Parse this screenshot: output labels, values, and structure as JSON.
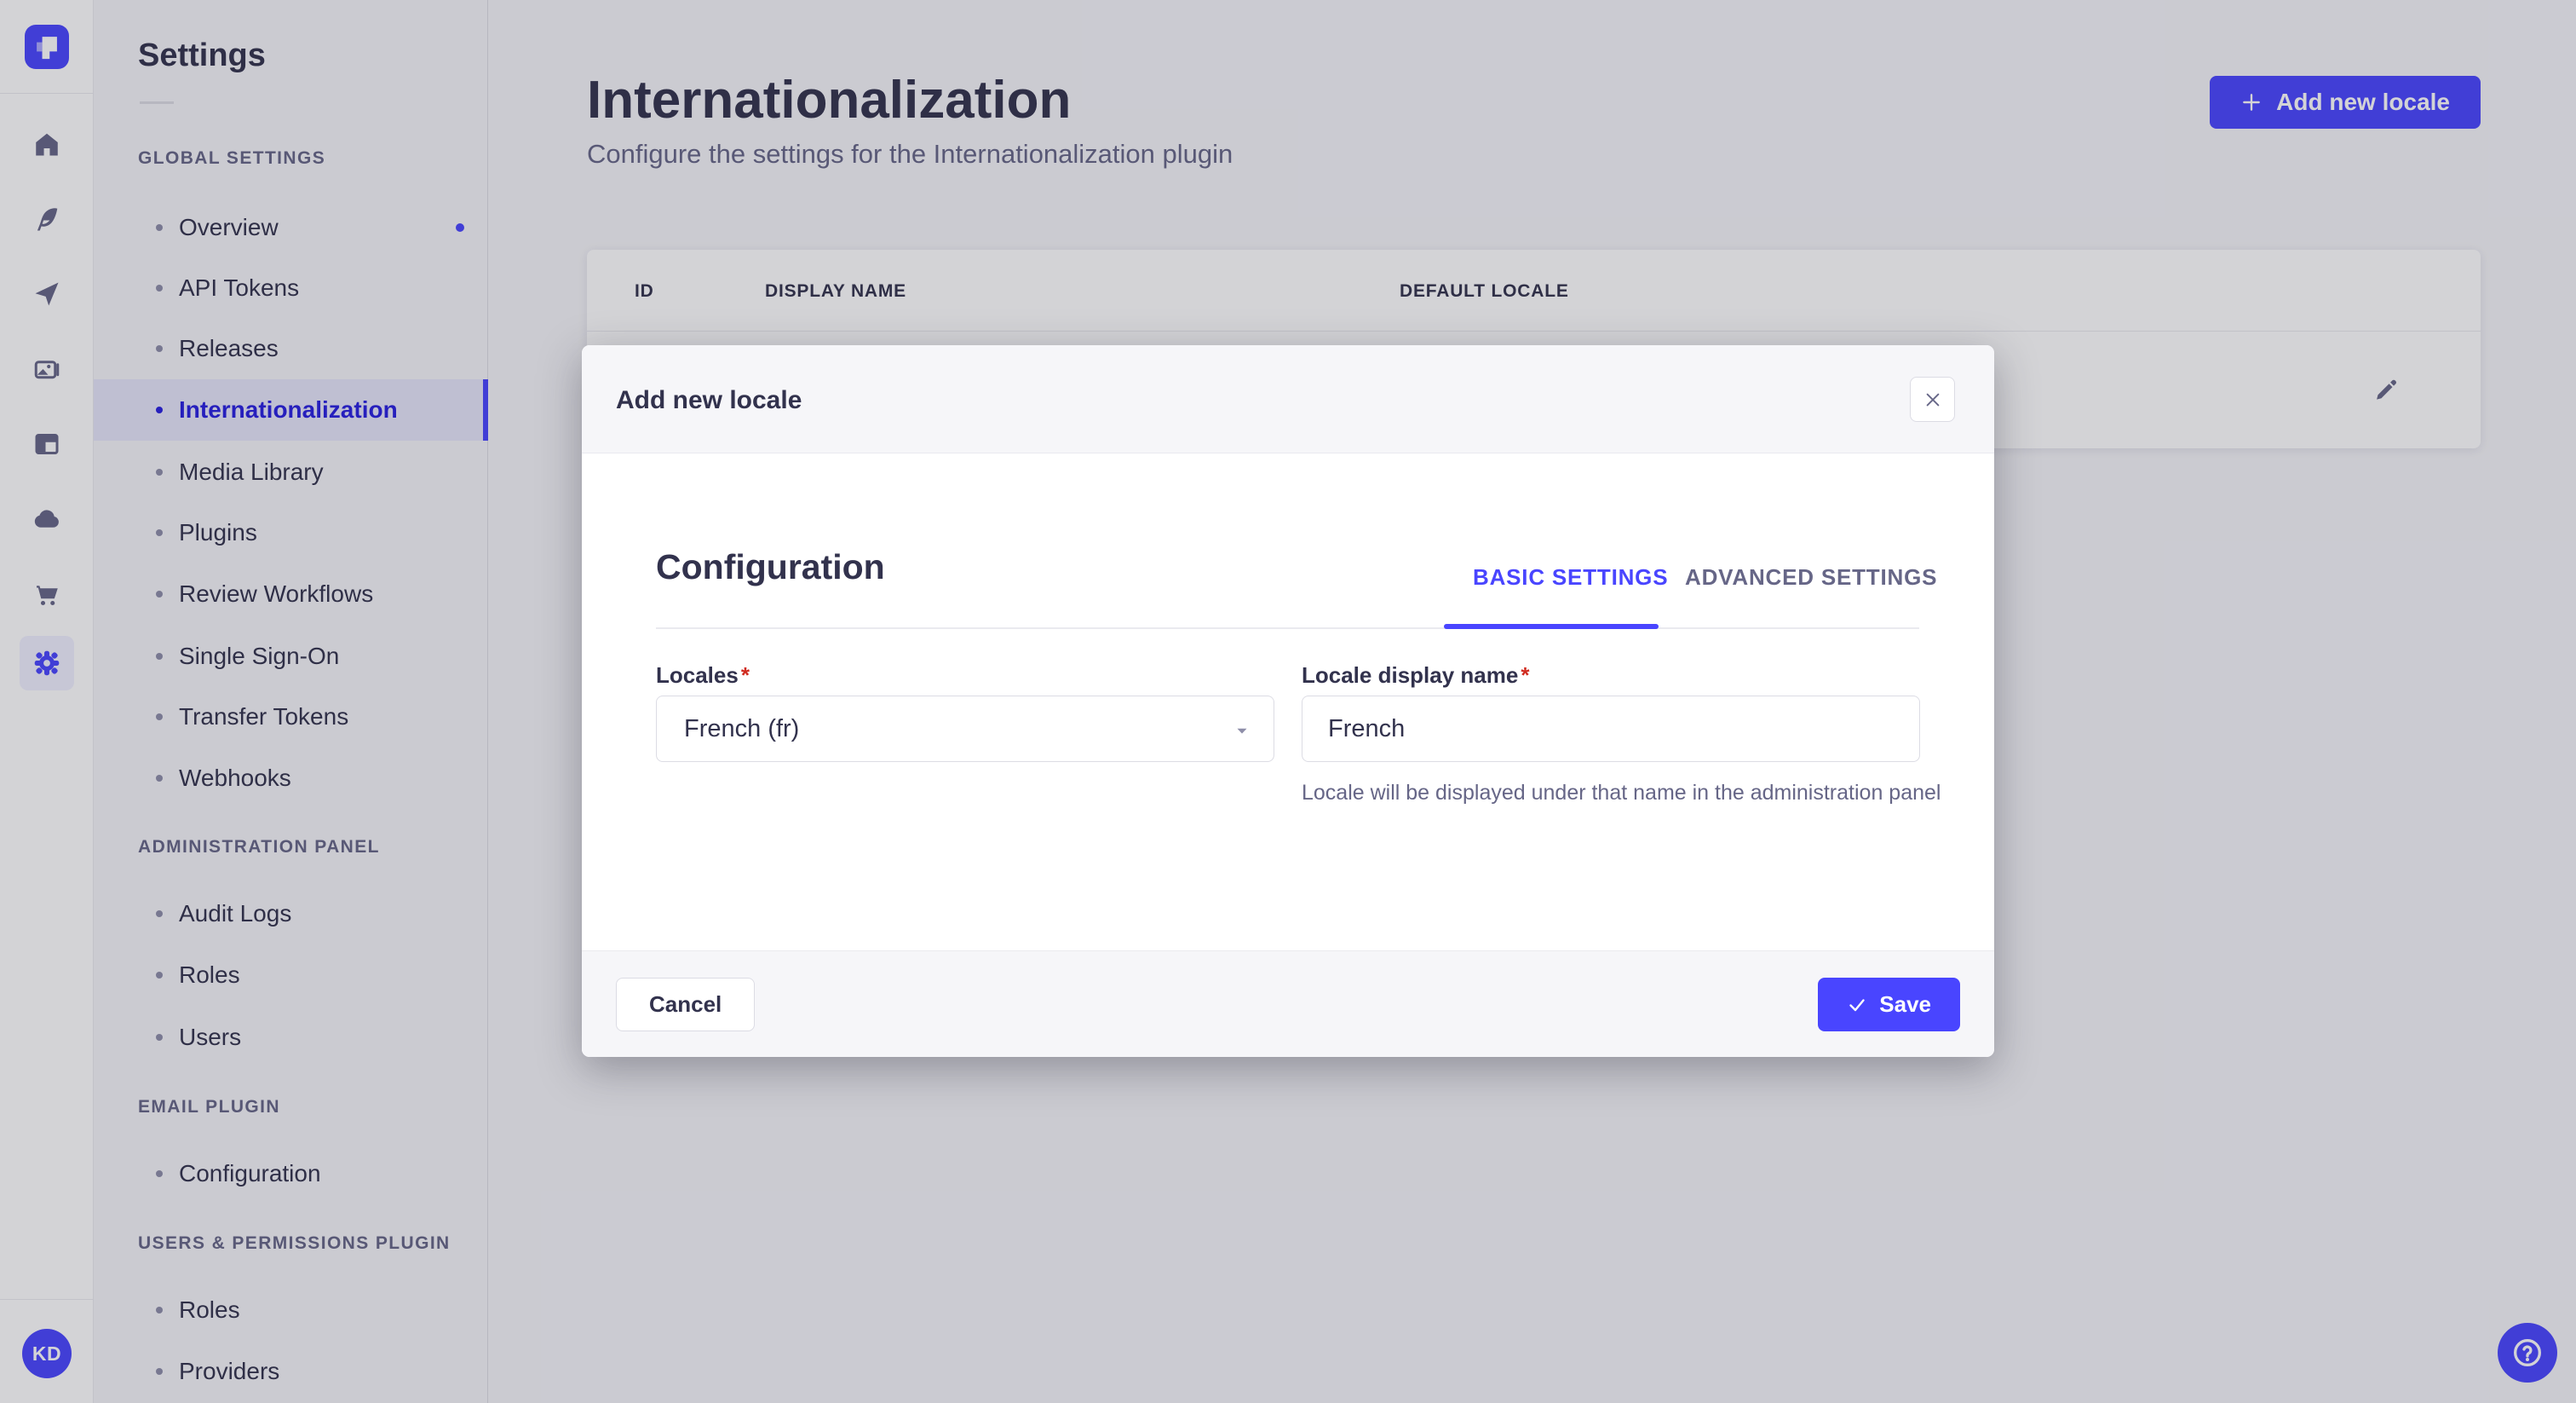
{
  "colors": {
    "brand": "#4945ff",
    "active_link": "#271fe0",
    "danger": "#d02b20",
    "overlay": "rgba(33,33,52,0.2)"
  },
  "rail": {
    "logo_icon": "strapi-logo-icon",
    "icons": [
      "home-icon",
      "feather-icon",
      "paper-plane-icon",
      "media-library-icon",
      "layout-icon",
      "cloud-icon",
      "cart-icon",
      "gear-icon"
    ],
    "active_icon": "gear-icon",
    "avatar_initials": "KD"
  },
  "sidebar": {
    "title": "Settings",
    "sections": [
      {
        "header": "GLOBAL SETTINGS",
        "items": [
          {
            "label": "Overview",
            "notification": true
          },
          {
            "label": "API Tokens"
          },
          {
            "label": "Releases"
          },
          {
            "label": "Internationalization",
            "active": true
          },
          {
            "label": "Media Library"
          },
          {
            "label": "Plugins"
          },
          {
            "label": "Review Workflows"
          },
          {
            "label": "Single Sign-On"
          },
          {
            "label": "Transfer Tokens"
          },
          {
            "label": "Webhooks"
          }
        ]
      },
      {
        "header": "ADMINISTRATION PANEL",
        "items": [
          {
            "label": "Audit Logs"
          },
          {
            "label": "Roles"
          },
          {
            "label": "Users"
          }
        ]
      },
      {
        "header": "EMAIL PLUGIN",
        "items": [
          {
            "label": "Configuration"
          }
        ]
      },
      {
        "header": "USERS & PERMISSIONS PLUGIN",
        "items": [
          {
            "label": "Roles"
          },
          {
            "label": "Providers"
          }
        ]
      }
    ]
  },
  "main": {
    "title": "Internationalization",
    "subtitle": "Configure the settings for the Internationalization plugin",
    "add_button_label": "Add new locale",
    "table": {
      "columns": [
        "ID",
        "DISPLAY NAME",
        "DEFAULT LOCALE"
      ],
      "row_action_icon": "edit-pencil-icon"
    }
  },
  "modal": {
    "title": "Add new locale",
    "close_icon": "close-icon",
    "section_title": "Configuration",
    "tabs": [
      {
        "label": "BASIC SETTINGS",
        "active": true
      },
      {
        "label": "ADVANCED SETTINGS",
        "active": false
      }
    ],
    "locales_field": {
      "label": "Locales",
      "required": "*",
      "value": "French (fr)",
      "dropdown_icon": "caret-down-icon"
    },
    "display_name_field": {
      "label": "Locale display name",
      "required": "*",
      "value": "French",
      "hint": "Locale will be displayed under that name in the administration panel"
    },
    "cancel_label": "Cancel",
    "save_label": "Save",
    "save_icon": "check-icon"
  },
  "help": {
    "icon": "question-mark-icon"
  }
}
